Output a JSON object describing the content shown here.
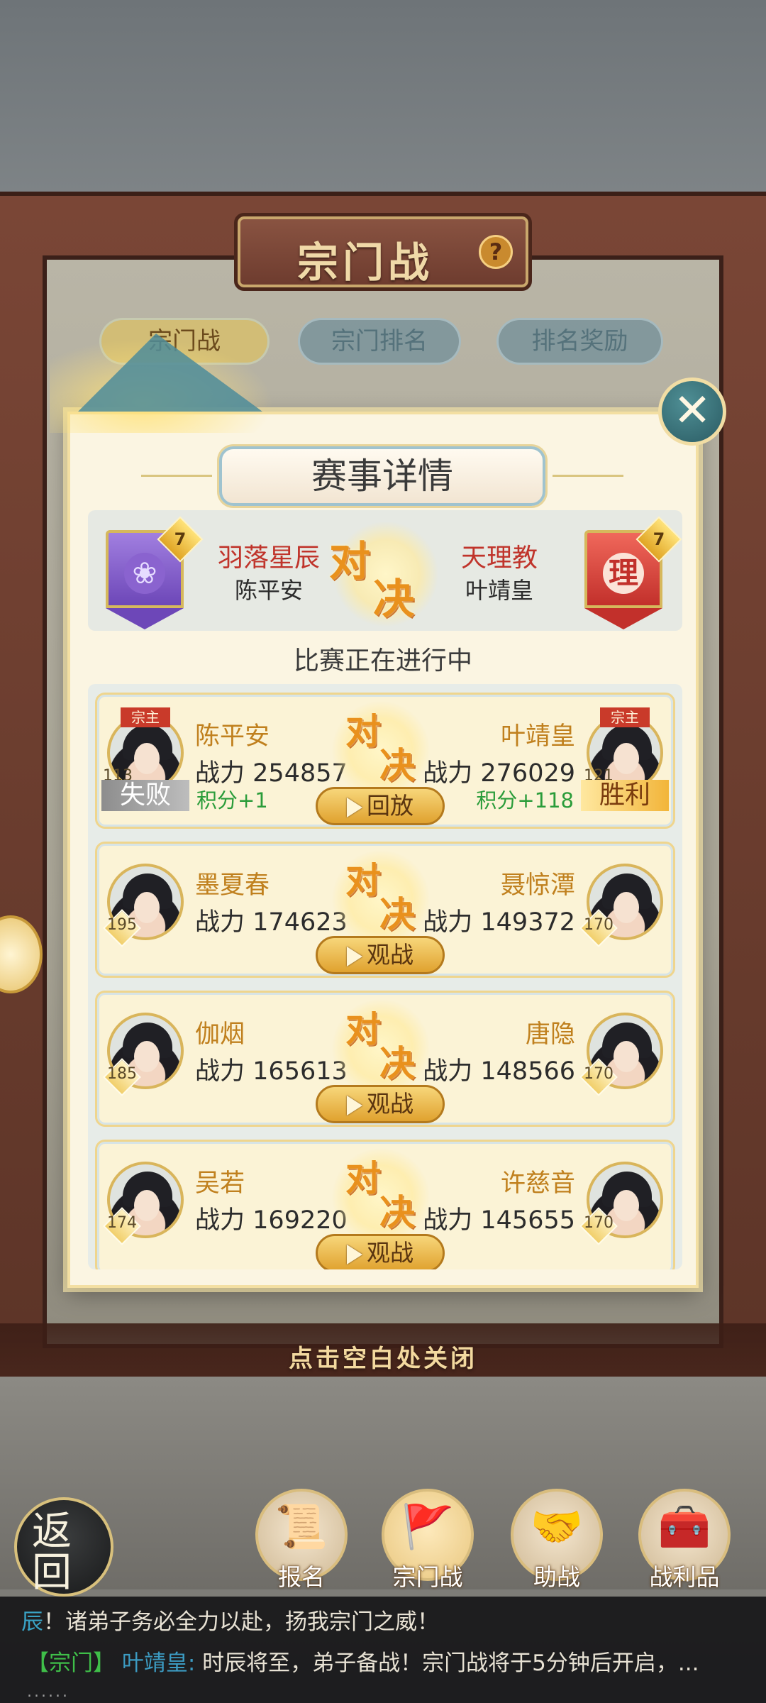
{
  "background": {
    "title": "宗门战",
    "help_icon": "?",
    "tabs": [
      "宗门战",
      "宗门排名",
      "排名奖励"
    ]
  },
  "modal": {
    "title": "赛事详情",
    "close_icon": "✕",
    "vs_chars": [
      "对",
      "决"
    ],
    "team_left": {
      "name": "羽落星辰",
      "leader": "陈平安",
      "level": "7",
      "emblem": "lotus-icon"
    },
    "team_right": {
      "name": "天理教",
      "leader": "叶靖皇",
      "level": "7",
      "emblem": "理"
    },
    "status": "比赛正在进行中",
    "power_prefix": "战力",
    "sect_leader_badge": "宗主",
    "matches": [
      {
        "left": {
          "name": "陈平安",
          "power": "254857",
          "level": "113",
          "result": "失败",
          "points": "积分+1"
        },
        "right": {
          "name": "叶靖皇",
          "power": "276029",
          "level": "121",
          "result": "胜利",
          "points": "积分+118"
        },
        "button": "回放"
      },
      {
        "left": {
          "name": "墨夏春",
          "power": "174623",
          "level": "195"
        },
        "right": {
          "name": "聂惊潭",
          "power": "149372",
          "level": "170"
        },
        "button": "观战"
      },
      {
        "left": {
          "name": "伽烟",
          "power": "165613",
          "level": "185"
        },
        "right": {
          "name": "唐隐",
          "power": "148566",
          "level": "170"
        },
        "button": "观战"
      },
      {
        "left": {
          "name": "吴若",
          "power": "169220",
          "level": "174"
        },
        "right": {
          "name": "许慈音",
          "power": "145655",
          "level": "170"
        },
        "button": "观战"
      }
    ]
  },
  "close_hint": "点击空白处关闭",
  "nav": {
    "back": "返回",
    "items": [
      "报名",
      "宗门战",
      "助战",
      "战利品"
    ]
  },
  "chat": {
    "line1_prefix": "辰",
    "line1_text": "！诸弟子务必全力以赴，扬我宗门之威！",
    "line2_tag": "【宗门】",
    "line2_speaker": "叶靖皇:",
    "line2_text": "时辰将至，弟子备战！宗门战将于5分钟后开启，...",
    "dots": "......"
  },
  "colors": {
    "accent": "#e9911d",
    "win": "#f2b53a",
    "lose": "#8d8d8d",
    "points": "#2a9c3a"
  }
}
